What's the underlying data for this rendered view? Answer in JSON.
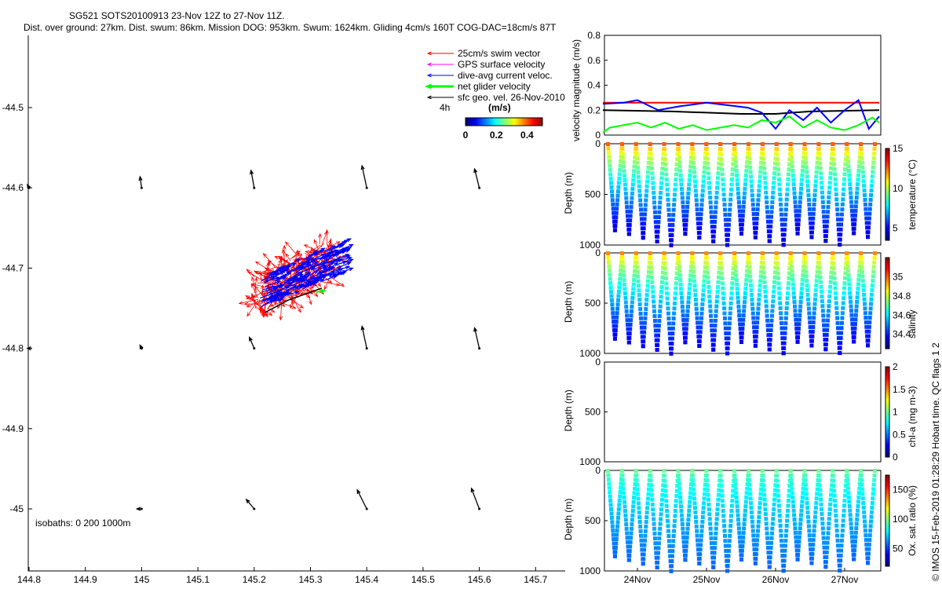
{
  "title": {
    "line1": "SG521 SOTS20100913 23-Nov 12Z to 27-Nov 11Z.",
    "line2": "Dist. over ground: 27km. Dist. swum: 86km. Mission DOG: 953km. Swum: 1624km. Gliding 4cm/s 160T COG-DAC=18cm/s 87T"
  },
  "footer": "© IMOS 15-Feb-2019 01:28:29 Hobart time. QC flags 1  2",
  "chart_data": [
    {
      "type": "scatter",
      "name": "map",
      "xlim": [
        144.8,
        145.75
      ],
      "ylim": [
        -45.08,
        -44.41
      ],
      "xticks": [
        "144.8",
        "144.9",
        "145",
        "145.1",
        "145.2",
        "145.3",
        "145.4",
        "145.5",
        "145.6",
        "145.7"
      ],
      "yticks": [
        "-44.5",
        "-44.6",
        "-44.7",
        "-44.8",
        "-44.9",
        "-45"
      ],
      "legend": [
        {
          "label": "25cm/s swim vector",
          "color": "#ff0000"
        },
        {
          "label": "GPS surface velocity",
          "color": "#ff00ff"
        },
        {
          "label": "dive-avg current veloc.",
          "color": "#0000ff"
        },
        {
          "label": "net glider velocity",
          "color": "#00ff00"
        },
        {
          "label": "sfc geo. vel. 26-Nov-2010",
          "color": "#000000"
        }
      ],
      "legend_note": "4h",
      "colorbar": {
        "label": "(m/s)",
        "ticks": [
          "0",
          "0.2",
          "0.4"
        ],
        "range": [
          0,
          0.5
        ]
      },
      "isobaths_label": "isobaths: 0   200   1000m",
      "geo_vectors": [
        {
          "lon": 145.0,
          "lat": -44.6,
          "u": -0.01,
          "v": 0.07
        },
        {
          "lon": 145.2,
          "lat": -44.6,
          "u": -0.02,
          "v": 0.11
        },
        {
          "lon": 145.4,
          "lat": -44.6,
          "u": -0.03,
          "v": 0.14
        },
        {
          "lon": 145.6,
          "lat": -44.6,
          "u": -0.03,
          "v": 0.12
        },
        {
          "lon": 144.8,
          "lat": -44.6,
          "u": -0.01,
          "v": 0.02
        },
        {
          "lon": 145.0,
          "lat": -44.8,
          "u": -0.01,
          "v": 0.02
        },
        {
          "lon": 145.2,
          "lat": -44.8,
          "u": -0.03,
          "v": 0.07
        },
        {
          "lon": 145.4,
          "lat": -44.8,
          "u": -0.03,
          "v": 0.14
        },
        {
          "lon": 145.6,
          "lat": -44.8,
          "u": -0.03,
          "v": 0.13
        },
        {
          "lon": 144.8,
          "lat": -44.8,
          "u": -0.01,
          "v": 0.0
        },
        {
          "lon": 145.0,
          "lat": -45.0,
          "u": -0.03,
          "v": 0.0
        },
        {
          "lon": 145.2,
          "lat": -45.0,
          "u": -0.05,
          "v": 0.06
        },
        {
          "lon": 145.4,
          "lat": -45.0,
          "u": -0.06,
          "v": 0.12
        },
        {
          "lon": 145.6,
          "lat": -45.0,
          "u": -0.05,
          "v": 0.13
        }
      ]
    },
    {
      "type": "line",
      "name": "velocity",
      "ylabel": "velocity magnitude (m/s)",
      "ylim": [
        0,
        0.8
      ],
      "yticks": [
        "0",
        "0.2",
        "0.4",
        "0.6",
        "0.8"
      ],
      "x_days": [
        23.5,
        27.5
      ],
      "series": [
        {
          "color": "#ff0000",
          "x": [
            23.5,
            27.5
          ],
          "y": [
            0.26,
            0.26
          ]
        },
        {
          "color": "#000000",
          "x": [
            23.5,
            24.5,
            25.5,
            26.0,
            26.5,
            27.5
          ],
          "y": [
            0.2,
            0.19,
            0.17,
            0.17,
            0.19,
            0.2
          ]
        },
        {
          "color": "#0000ff",
          "x": [
            23.5,
            23.8,
            24.0,
            24.3,
            24.6,
            25.0,
            25.3,
            25.6,
            25.8,
            26.0,
            26.2,
            26.4,
            26.6,
            26.8,
            27.0,
            27.2,
            27.35,
            27.5
          ],
          "y": [
            0.25,
            0.26,
            0.28,
            0.2,
            0.23,
            0.26,
            0.24,
            0.22,
            0.18,
            0.05,
            0.2,
            0.12,
            0.22,
            0.1,
            0.2,
            0.28,
            0.05,
            0.15
          ]
        },
        {
          "color": "#00ff00",
          "x": [
            23.5,
            23.6,
            23.8,
            24.0,
            24.2,
            24.4,
            24.6,
            24.8,
            25.0,
            25.2,
            25.4,
            25.6,
            25.8,
            26.0,
            26.2,
            26.4,
            26.6,
            26.8,
            27.0,
            27.2,
            27.4,
            27.5
          ],
          "y": [
            0.02,
            0.06,
            0.08,
            0.1,
            0.06,
            0.1,
            0.05,
            0.08,
            0.04,
            0.06,
            0.08,
            0.06,
            0.12,
            0.1,
            0.15,
            0.06,
            0.12,
            0.06,
            0.04,
            0.08,
            0.14,
            0.1
          ]
        }
      ]
    },
    {
      "type": "scatter",
      "name": "temperature",
      "ylabel": "Depth (m)",
      "yticks": [
        "0",
        "500",
        "1000"
      ],
      "cbar_label": "temperature (°C)",
      "cbar_ticks": [
        "5",
        "10",
        "15"
      ],
      "crange": [
        3.5,
        15
      ],
      "surface": 12.5,
      "bottom": 4.5
    },
    {
      "type": "scatter",
      "name": "salinity",
      "ylabel": "Depth (m)",
      "yticks": [
        "0",
        "500",
        "1000"
      ],
      "cbar_label": "salinity",
      "cbar_ticks": [
        "34.4",
        "34.6",
        "34.8",
        "35"
      ],
      "crange": [
        34.25,
        35.2
      ],
      "surface": 34.95,
      "bottom": 34.35
    },
    {
      "type": "scatter",
      "name": "chl",
      "ylabel": "Depth (m)",
      "yticks": [
        "0",
        "500",
        "1000"
      ],
      "cbar_label": "chl-a (mg m-3)",
      "cbar_ticks": [
        "0",
        "0.5",
        "1",
        "1.5",
        "2"
      ],
      "crange": [
        0,
        2
      ]
    },
    {
      "type": "scatter",
      "name": "oxygen",
      "ylabel": "Depth (m)",
      "yticks": [
        "0",
        "500",
        "1000"
      ],
      "cbar_label": "Ox. sat. ratio (%)",
      "cbar_ticks": [
        "50",
        "100",
        "150"
      ],
      "crange": [
        20,
        175
      ],
      "surface": 95,
      "bottom": 55,
      "xticks": [
        "24Nov",
        "25Nov",
        "26Nov",
        "27Nov"
      ]
    }
  ]
}
